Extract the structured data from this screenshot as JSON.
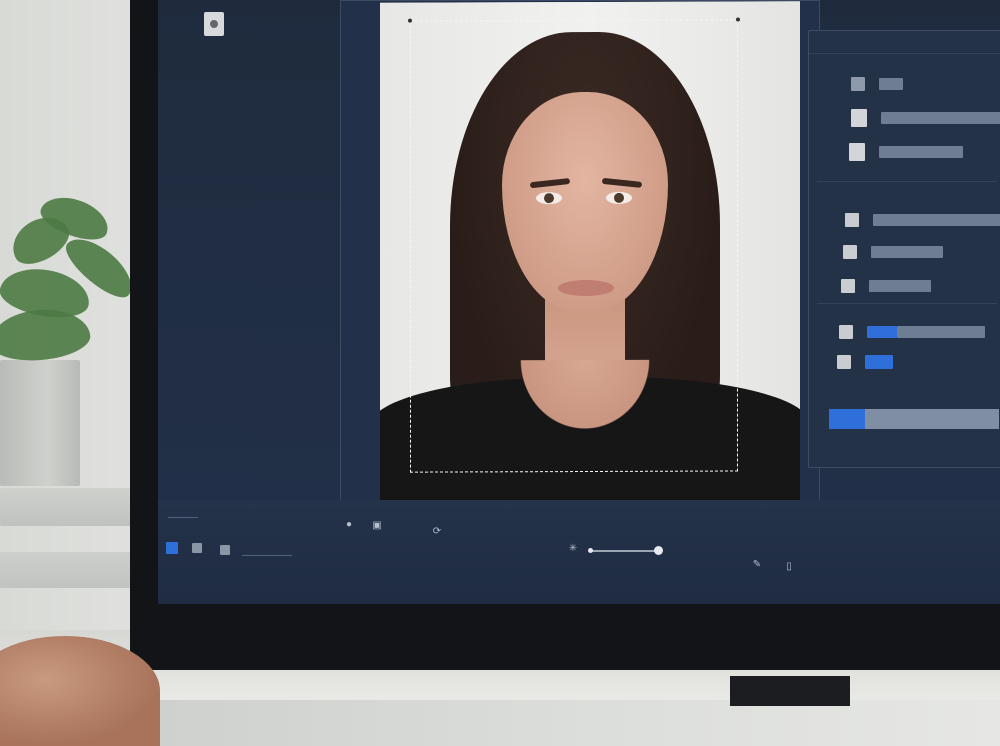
{
  "toolbar": {
    "top_label": "———",
    "bottom_label": "—————"
  },
  "slider": {
    "value": 0.95
  },
  "panel": {
    "progress": 0.21
  },
  "icons": {
    "rail_thumb": "image-thumbnail-icon",
    "tool_1": "circle-icon",
    "tool_2": "square-icon",
    "tool_3": "rotate-icon",
    "brightness": "sun-icon",
    "pen": "pen-icon",
    "doc": "document-icon"
  },
  "colors": {
    "accent": "#2f6fd9",
    "panel": "#243247",
    "screen": "#1f2b3d"
  }
}
